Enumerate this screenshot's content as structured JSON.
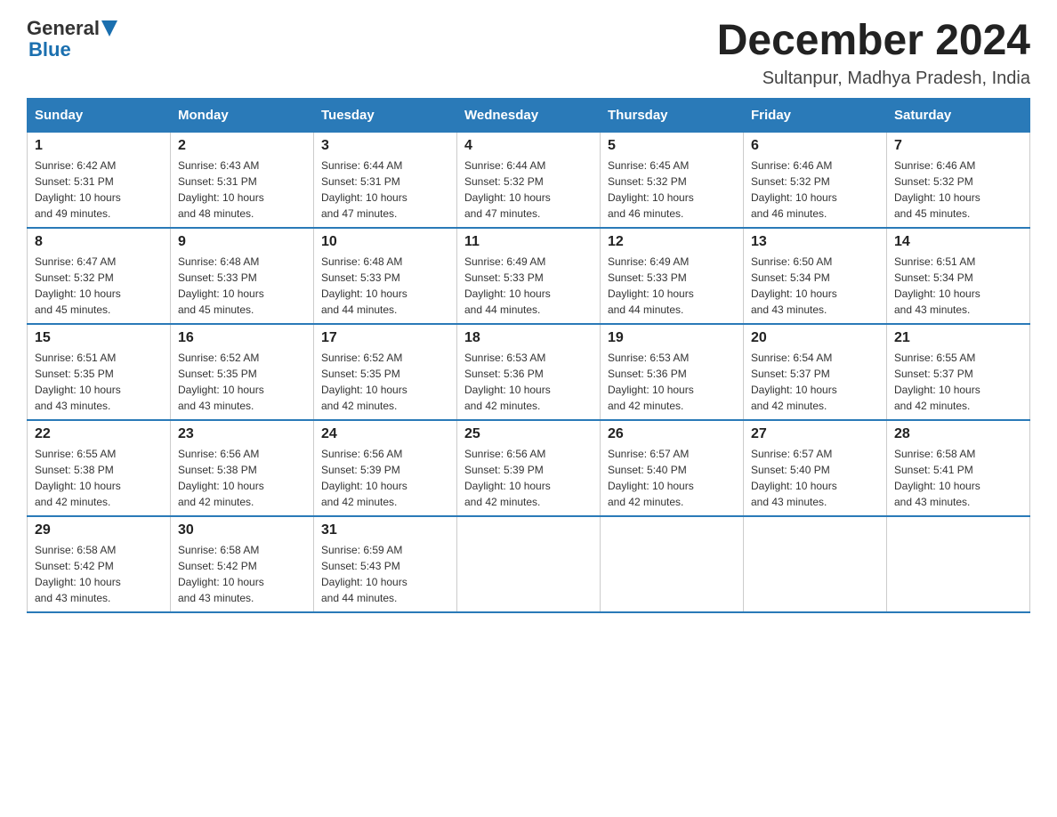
{
  "header": {
    "logo_general": "General",
    "logo_blue": "Blue",
    "month_title": "December 2024",
    "location": "Sultanpur, Madhya Pradesh, India"
  },
  "weekdays": [
    "Sunday",
    "Monday",
    "Tuesday",
    "Wednesday",
    "Thursday",
    "Friday",
    "Saturday"
  ],
  "weeks": [
    [
      {
        "day": "1",
        "sunrise": "6:42 AM",
        "sunset": "5:31 PM",
        "daylight": "10 hours and 49 minutes."
      },
      {
        "day": "2",
        "sunrise": "6:43 AM",
        "sunset": "5:31 PM",
        "daylight": "10 hours and 48 minutes."
      },
      {
        "day": "3",
        "sunrise": "6:44 AM",
        "sunset": "5:31 PM",
        "daylight": "10 hours and 47 minutes."
      },
      {
        "day": "4",
        "sunrise": "6:44 AM",
        "sunset": "5:32 PM",
        "daylight": "10 hours and 47 minutes."
      },
      {
        "day": "5",
        "sunrise": "6:45 AM",
        "sunset": "5:32 PM",
        "daylight": "10 hours and 46 minutes."
      },
      {
        "day": "6",
        "sunrise": "6:46 AM",
        "sunset": "5:32 PM",
        "daylight": "10 hours and 46 minutes."
      },
      {
        "day": "7",
        "sunrise": "6:46 AM",
        "sunset": "5:32 PM",
        "daylight": "10 hours and 45 minutes."
      }
    ],
    [
      {
        "day": "8",
        "sunrise": "6:47 AM",
        "sunset": "5:32 PM",
        "daylight": "10 hours and 45 minutes."
      },
      {
        "day": "9",
        "sunrise": "6:48 AM",
        "sunset": "5:33 PM",
        "daylight": "10 hours and 45 minutes."
      },
      {
        "day": "10",
        "sunrise": "6:48 AM",
        "sunset": "5:33 PM",
        "daylight": "10 hours and 44 minutes."
      },
      {
        "day": "11",
        "sunrise": "6:49 AM",
        "sunset": "5:33 PM",
        "daylight": "10 hours and 44 minutes."
      },
      {
        "day": "12",
        "sunrise": "6:49 AM",
        "sunset": "5:33 PM",
        "daylight": "10 hours and 44 minutes."
      },
      {
        "day": "13",
        "sunrise": "6:50 AM",
        "sunset": "5:34 PM",
        "daylight": "10 hours and 43 minutes."
      },
      {
        "day": "14",
        "sunrise": "6:51 AM",
        "sunset": "5:34 PM",
        "daylight": "10 hours and 43 minutes."
      }
    ],
    [
      {
        "day": "15",
        "sunrise": "6:51 AM",
        "sunset": "5:35 PM",
        "daylight": "10 hours and 43 minutes."
      },
      {
        "day": "16",
        "sunrise": "6:52 AM",
        "sunset": "5:35 PM",
        "daylight": "10 hours and 43 minutes."
      },
      {
        "day": "17",
        "sunrise": "6:52 AM",
        "sunset": "5:35 PM",
        "daylight": "10 hours and 42 minutes."
      },
      {
        "day": "18",
        "sunrise": "6:53 AM",
        "sunset": "5:36 PM",
        "daylight": "10 hours and 42 minutes."
      },
      {
        "day": "19",
        "sunrise": "6:53 AM",
        "sunset": "5:36 PM",
        "daylight": "10 hours and 42 minutes."
      },
      {
        "day": "20",
        "sunrise": "6:54 AM",
        "sunset": "5:37 PM",
        "daylight": "10 hours and 42 minutes."
      },
      {
        "day": "21",
        "sunrise": "6:55 AM",
        "sunset": "5:37 PM",
        "daylight": "10 hours and 42 minutes."
      }
    ],
    [
      {
        "day": "22",
        "sunrise": "6:55 AM",
        "sunset": "5:38 PM",
        "daylight": "10 hours and 42 minutes."
      },
      {
        "day": "23",
        "sunrise": "6:56 AM",
        "sunset": "5:38 PM",
        "daylight": "10 hours and 42 minutes."
      },
      {
        "day": "24",
        "sunrise": "6:56 AM",
        "sunset": "5:39 PM",
        "daylight": "10 hours and 42 minutes."
      },
      {
        "day": "25",
        "sunrise": "6:56 AM",
        "sunset": "5:39 PM",
        "daylight": "10 hours and 42 minutes."
      },
      {
        "day": "26",
        "sunrise": "6:57 AM",
        "sunset": "5:40 PM",
        "daylight": "10 hours and 42 minutes."
      },
      {
        "day": "27",
        "sunrise": "6:57 AM",
        "sunset": "5:40 PM",
        "daylight": "10 hours and 43 minutes."
      },
      {
        "day": "28",
        "sunrise": "6:58 AM",
        "sunset": "5:41 PM",
        "daylight": "10 hours and 43 minutes."
      }
    ],
    [
      {
        "day": "29",
        "sunrise": "6:58 AM",
        "sunset": "5:42 PM",
        "daylight": "10 hours and 43 minutes."
      },
      {
        "day": "30",
        "sunrise": "6:58 AM",
        "sunset": "5:42 PM",
        "daylight": "10 hours and 43 minutes."
      },
      {
        "day": "31",
        "sunrise": "6:59 AM",
        "sunset": "5:43 PM",
        "daylight": "10 hours and 44 minutes."
      },
      null,
      null,
      null,
      null
    ]
  ],
  "labels": {
    "sunrise_prefix": "Sunrise: ",
    "sunset_prefix": "Sunset: ",
    "daylight_prefix": "Daylight: "
  }
}
